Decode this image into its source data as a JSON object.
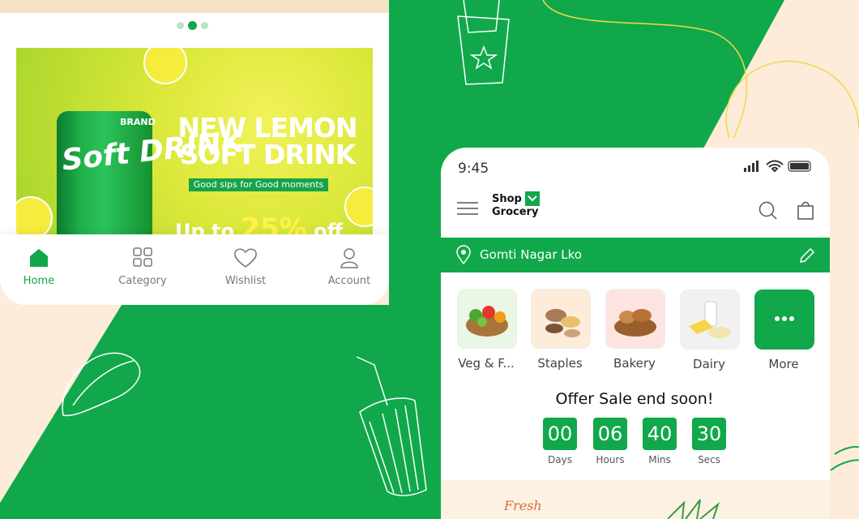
{
  "colors": {
    "brand": "#10a84a",
    "cream": "#fcecd9"
  },
  "left_phone": {
    "carousel": {
      "total": 3,
      "active_index": 1
    },
    "banner": {
      "can_brand": "BRAND",
      "can_text": "Soft DRINK",
      "title": "NEW LEMON SOFT DRINK",
      "tagline": "Good sips for Good moments",
      "promo_prefix": "Up to",
      "promo_value": "25%",
      "promo_suffix": "off"
    },
    "bottom_nav": [
      {
        "label": "Home",
        "icon": "home-icon",
        "active": true
      },
      {
        "label": "Category",
        "icon": "grid-icon",
        "active": false
      },
      {
        "label": "Wishlist",
        "icon": "heart-icon",
        "active": false
      },
      {
        "label": "Account",
        "icon": "user-icon",
        "active": false
      }
    ]
  },
  "right_phone": {
    "status_bar": {
      "time": "9:45"
    },
    "header": {
      "logo_line1": "Shop",
      "logo_line2": "Grocery"
    },
    "location": {
      "text": "Gomti Nagar Lko"
    },
    "categories": [
      {
        "label": "Veg & F...",
        "icon": "vegetables-icon"
      },
      {
        "label": "Staples",
        "icon": "staples-icon"
      },
      {
        "label": "Bakery",
        "icon": "bakery-icon"
      },
      {
        "label": "Dairy",
        "icon": "dairy-icon"
      },
      {
        "label": "More",
        "icon": "more-icon"
      }
    ],
    "offer": {
      "title": "Offer Sale end soon!",
      "countdown": [
        {
          "value": "00",
          "label": "Days"
        },
        {
          "value": "06",
          "label": "Hours"
        },
        {
          "value": "40",
          "label": "Mins"
        },
        {
          "value": "30",
          "label": "Secs"
        }
      ]
    },
    "fresh_banner": {
      "text": "Fresh"
    }
  }
}
